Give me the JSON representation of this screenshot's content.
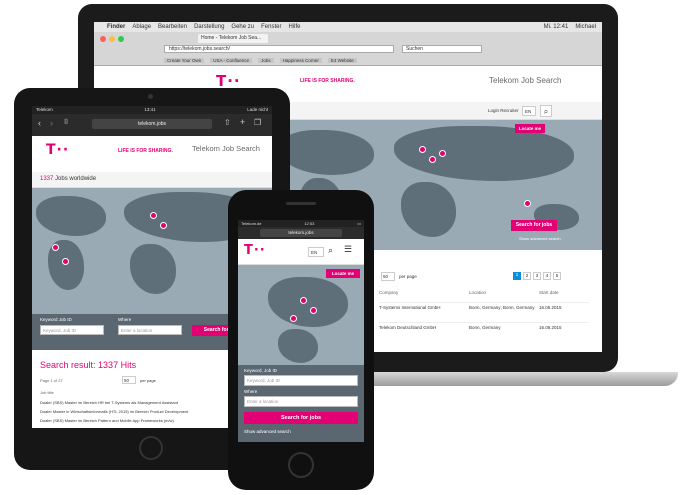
{
  "laptop": {
    "menubar": {
      "items": [
        "Finder",
        "Ablage",
        "Bearbeiten",
        "Darstellung",
        "Gehe zu",
        "Fenster",
        "Hilfe"
      ],
      "clock": "Mi. 12:41",
      "user": "Michael"
    },
    "browser": {
      "tab_label": "Home - Telekom Job Sea...",
      "url": "https://telekom.jobs.search/",
      "search_placeholder": "Suchen",
      "bookmarks": [
        "Create Your Own",
        "USA - Confluence",
        "Jobs",
        "Happiness Corner",
        "E4 Website"
      ]
    },
    "page": {
      "logo": "T··",
      "slogan": "LIFE IS FOR SHARING.",
      "title": "Telekom Job Search",
      "lang": "EN",
      "login": "Login Recruiter",
      "locate_me": "Locate me",
      "search_button": "Search for jobs",
      "advanced": "Show advanced search",
      "per_page": "50",
      "per_page_label": "per page",
      "pages": [
        "1",
        "2",
        "3",
        "4",
        "5"
      ],
      "columns": [
        "Company",
        "Location",
        "Start date"
      ],
      "rows": [
        [
          "T-Systems International GmbH",
          "Bonn, Germany; Bonn, Germany",
          "16.06.2015"
        ],
        [
          "Telekom Deutschland GmbH",
          "Bonn, Germany",
          "16.06.2015"
        ]
      ]
    }
  },
  "tablet": {
    "status_left": "Telekom",
    "status_time": "13:41",
    "status_right": "Lade nicht",
    "url": "telekom.jobs",
    "page": {
      "logo": "T··",
      "slogan": "LIFE IS FOR SHARING.",
      "title": "Telekom Job Search",
      "jobs_count": "1337",
      "jobs_label": "Jobs worldwide",
      "keyword_label": "Keyword Job ID",
      "keyword_placeholder": "Keyword, Job ID",
      "where_label": "Where",
      "where_placeholder": "Enter a location",
      "search_button": "Search for jobs",
      "result_prefix": "Search result:",
      "result_hits": "1337 Hits",
      "page_info": "Page 1 of 27",
      "per_page": "50",
      "per_page_label": "per page",
      "job_title_header": "Job title",
      "jobs": [
        "Dualer (SBS) Master im Bereich HR bei T-Systems als Management Assistant",
        "Dualer Master in Wirtschaftsinformatik (HTL 2015) im Bereich Product Development",
        "Dualer (SBS) Master im Bereich Pattern and Mobile App Frameworks (m/w)"
      ]
    }
  },
  "phone": {
    "status_left": "Telekom.de",
    "status_time": "12:53",
    "url": "telekom.jobs",
    "page": {
      "logo": "T··",
      "lang": "EN",
      "locate_me": "Locate me",
      "keyword_label": "Keyword, Job ID",
      "keyword_placeholder": "Keyword, Job ID",
      "where_label": "Where",
      "where_placeholder": "Enter a location",
      "search_button": "Search for jobs",
      "advanced": "Show advanced search"
    }
  },
  "colors": {
    "magenta": "#e20074",
    "map_sea": "#9aaab5",
    "map_land": "#5f6f7a"
  }
}
